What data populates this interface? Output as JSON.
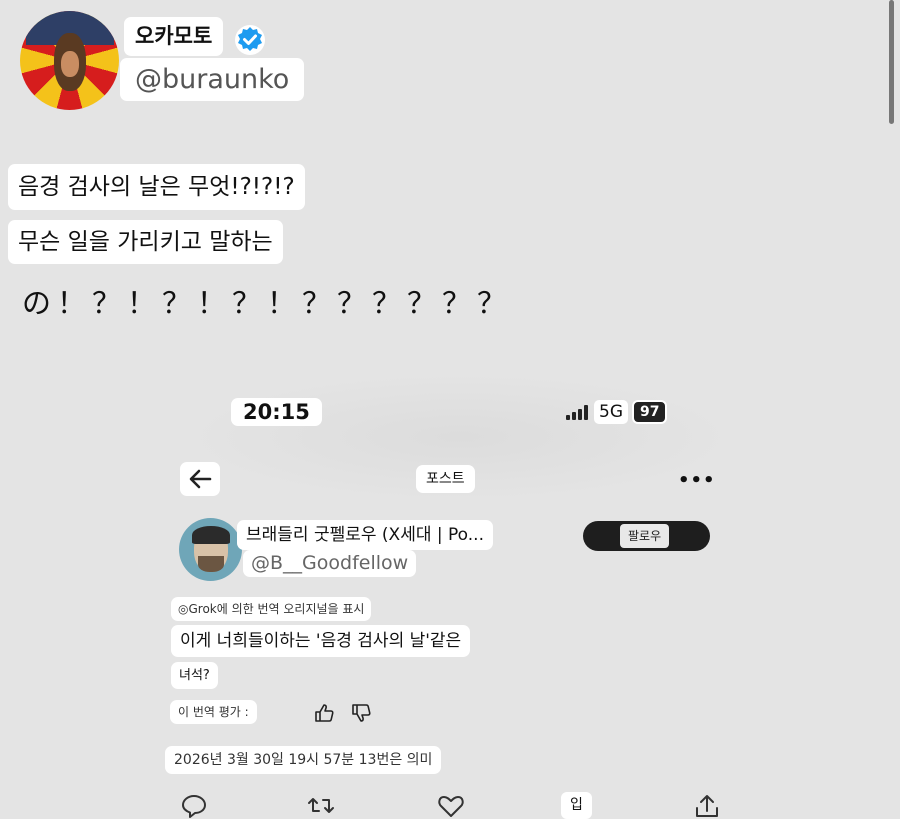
{
  "post": {
    "display_name": "오카모토",
    "handle": "@buraunko",
    "line1": "음경 검사의 날은 무엇!?!?!?",
    "line2": "무슨 일을 가리키고 말하는",
    "line3": "の！？！？！？！？？？？？？"
  },
  "screenshot": {
    "status_time": "20:15",
    "network": "5G",
    "battery": "97",
    "nav_title": "포스트",
    "author_name": "브래들리 굿펠로우 (X세대 | Po...",
    "author_handle": "@B__Goodfellow",
    "follow_label": "팔로우",
    "grok_note": "◎Grok에 의한 번역 오리지널을 표시",
    "translation_line1": "이게 너희들이하는 '음경 검사의 날'같은",
    "translation_line2": "녀석?",
    "rate_label": "이 번역 평가 :",
    "meta": "2026년 3월 30일 19시 57분  13번은 의미",
    "action_label": "입"
  },
  "colors": {
    "verified": "#1d9bf0",
    "background": "#e4e4e4",
    "follow_button": "#1e1e1e"
  },
  "icons": [
    "verified-badge-icon",
    "back-arrow-icon",
    "more-icon",
    "thumbs-up-icon",
    "thumbs-down-icon",
    "reply-icon",
    "repost-icon",
    "like-icon",
    "share-icon",
    "signal-icon"
  ]
}
